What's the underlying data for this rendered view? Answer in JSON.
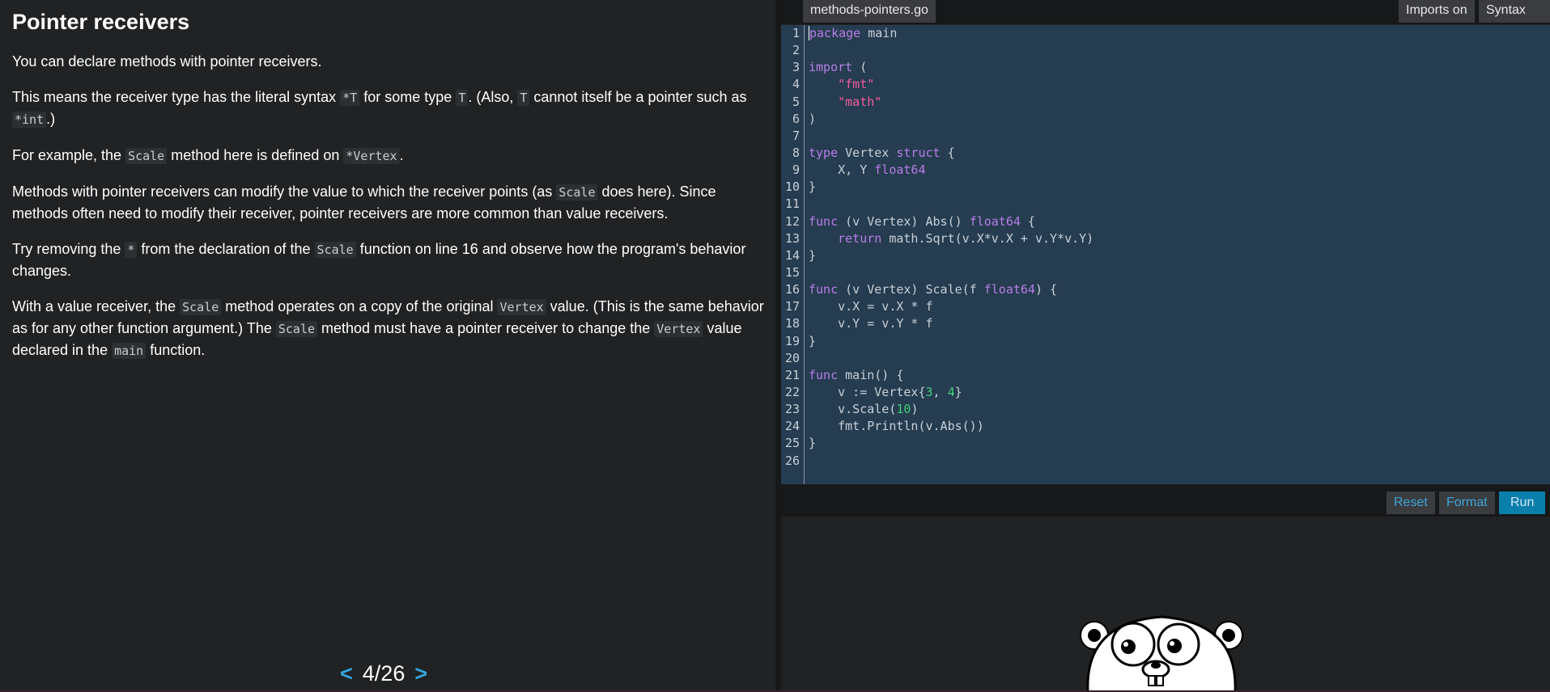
{
  "lesson": {
    "title": "Pointer receivers",
    "p1": "You can declare methods with pointer receivers.",
    "p2": {
      "a": "This means the receiver type has the literal syntax ",
      "c1": "*T",
      "b": " for some type ",
      "c2": "T",
      "c": ". (Also, ",
      "c3": "T",
      "d": " cannot itself be a pointer such as ",
      "c4": "*int",
      "e": ".)"
    },
    "p3": {
      "a": "For example, the ",
      "c1": "Scale",
      "b": " method here is defined on ",
      "c2": "*Vertex",
      "c": "."
    },
    "p4": {
      "a": "Methods with pointer receivers can modify the value to which the receiver points (as ",
      "c1": "Scale",
      "b": " does here). Since methods often need to modify their receiver, pointer receivers are more common than value receivers."
    },
    "p5": {
      "a": "Try removing the ",
      "c1": "*",
      "b": " from the declaration of the ",
      "c2": "Scale",
      "c": " function on line 16 and observe how the program's behavior changes."
    },
    "p6": {
      "a": "With a value receiver, the ",
      "c1": "Scale",
      "b": " method operates on a copy of the original ",
      "c2": "Vertex",
      "c": " value. (This is the same behavior as for any other function argument.) The ",
      "c3": "Scale",
      "d": " method must have a pointer receiver to change the ",
      "c4": "Vertex",
      "e": " value declared in the ",
      "c5": "main",
      "f": " function."
    },
    "pager": {
      "prev": "<",
      "label": "4/26",
      "next": ">"
    }
  },
  "editor": {
    "filename": "methods-pointers.go",
    "imports_toggle": "Imports on",
    "syntax_toggle": "Syntax on",
    "line_numbers": [
      "1",
      "2",
      "3",
      "4",
      "5",
      "6",
      "7",
      "8",
      "9",
      "10",
      "11",
      "12",
      "13",
      "14",
      "15",
      "16",
      "17",
      "18",
      "19",
      "20",
      "21",
      "22",
      "23",
      "24",
      "25",
      "26"
    ],
    "lines": [
      [
        [
          "kw",
          "package"
        ],
        [
          "p",
          " main"
        ]
      ],
      [],
      [
        [
          "kw",
          "import"
        ],
        [
          "p",
          " ("
        ]
      ],
      [
        [
          "p",
          "    "
        ],
        [
          "str",
          "\"fmt\""
        ]
      ],
      [
        [
          "p",
          "    "
        ],
        [
          "str",
          "\"math\""
        ]
      ],
      [
        [
          "p",
          ")"
        ]
      ],
      [],
      [
        [
          "kw",
          "type"
        ],
        [
          "p",
          " Vertex "
        ],
        [
          "kw",
          "struct"
        ],
        [
          "p",
          " {"
        ]
      ],
      [
        [
          "p",
          "    X, Y "
        ],
        [
          "kw",
          "float64"
        ]
      ],
      [
        [
          "p",
          "}"
        ]
      ],
      [],
      [
        [
          "kw",
          "func"
        ],
        [
          "p",
          " (v Vertex) Abs() "
        ],
        [
          "kw",
          "float64"
        ],
        [
          "p",
          " {"
        ]
      ],
      [
        [
          "p",
          "    "
        ],
        [
          "kw",
          "return"
        ],
        [
          "p",
          " math.Sqrt(v.X*v.X + v.Y*v.Y)"
        ]
      ],
      [
        [
          "p",
          "}"
        ]
      ],
      [],
      [
        [
          "kw",
          "func"
        ],
        [
          "p",
          " (v Vertex) Scale(f "
        ],
        [
          "kw",
          "float64"
        ],
        [
          "p",
          ") {"
        ]
      ],
      [
        [
          "p",
          "    v.X = v.X * f"
        ]
      ],
      [
        [
          "p",
          "    v.Y = v.Y * f"
        ]
      ],
      [
        [
          "p",
          "}"
        ]
      ],
      [],
      [
        [
          "kw",
          "func"
        ],
        [
          "p",
          " main() {"
        ]
      ],
      [
        [
          "p",
          "    v := Vertex{"
        ],
        [
          "num",
          "3"
        ],
        [
          "p",
          ", "
        ],
        [
          "num",
          "4"
        ],
        [
          "p",
          "}"
        ]
      ],
      [
        [
          "p",
          "    v.Scale("
        ],
        [
          "num",
          "10"
        ],
        [
          "p",
          ")"
        ]
      ],
      [
        [
          "p",
          "    fmt.Println(v.Abs())"
        ]
      ],
      [
        [
          "p",
          "}"
        ]
      ],
      []
    ],
    "buttons": {
      "reset": "Reset",
      "format": "Format",
      "run": "Run"
    }
  },
  "colors": {
    "background": "#202224",
    "editor_bg": "#263c50",
    "keyword": "#b77fe7",
    "string": "#f25d9c",
    "number": "#43d17a",
    "link_accent": "#35a5dc",
    "run_button": "#0a7fab"
  },
  "icons": {
    "mascot": "gopher-mascot-icon",
    "prev": "chevron-left-icon",
    "next": "chevron-right-icon"
  }
}
